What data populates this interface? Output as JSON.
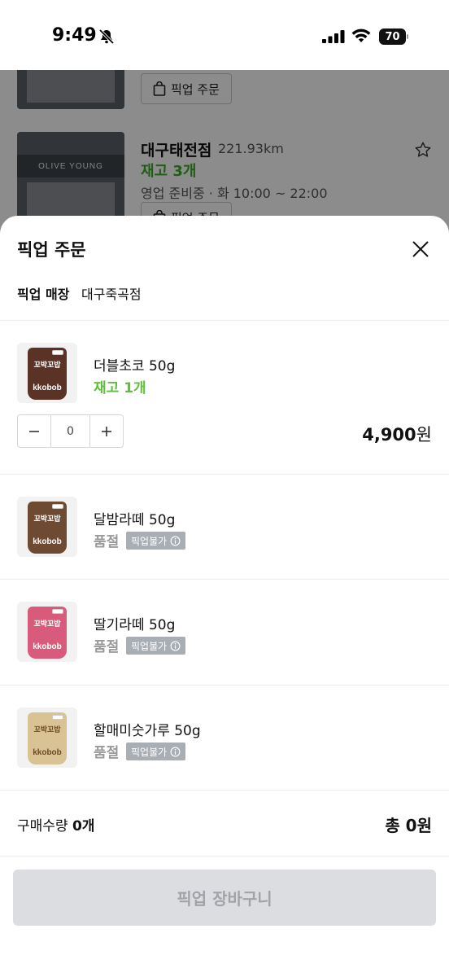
{
  "status_bar": {
    "time": "9:49",
    "battery": "70"
  },
  "background": {
    "pickup_button_label": "픽업 주문",
    "store": {
      "name": "대구태전점",
      "distance": "221.93km",
      "stock": "재고 3개",
      "hours": "영업 준비중 · 화 10:00 ~ 22:00",
      "sign_text": "OLIVE YOUNG"
    }
  },
  "sheet": {
    "title": "픽업 주문",
    "store_label": "픽업 매장",
    "store_name": "대구죽곡점",
    "products": [
      {
        "name": "더블초코 50g",
        "stock": "재고 1개",
        "quantity": "0",
        "price": "4,900",
        "price_unit": "원",
        "pouch_color": "#5b3326",
        "brand": "꼬박꼬밥",
        "logo": "kkobob"
      },
      {
        "name": "달밤라떼 50g",
        "status": "품절",
        "badge": "픽업불가",
        "pouch_color": "#6e4a33",
        "brand": "꼬박꼬밥",
        "logo": "kkobob"
      },
      {
        "name": "딸기라떼 50g",
        "status": "품절",
        "badge": "픽업불가",
        "pouch_color": "#d95b7c",
        "brand": "꼬박꼬밥",
        "logo": "kkobob"
      },
      {
        "name": "할매미숫가루 50g",
        "status": "품절",
        "badge": "픽업불가",
        "pouch_color": "#d9c394",
        "brand": "꼬박꼬밥",
        "logo": "kkobob"
      }
    ],
    "summary": {
      "qty_label": "구매수량",
      "qty_value": "0개",
      "total": "총 0원"
    },
    "cart_button": "픽업 장바구니"
  },
  "colors": {
    "stock_green": "#5dbf3a",
    "disabled_button": "#dcdde0",
    "badge_gray": "#a9adb4"
  },
  "icons": [
    "bell-slash-icon",
    "signal-icon",
    "wifi-icon",
    "bag-icon",
    "star-icon",
    "close-icon",
    "minus-icon",
    "plus-icon",
    "info-icon"
  ]
}
